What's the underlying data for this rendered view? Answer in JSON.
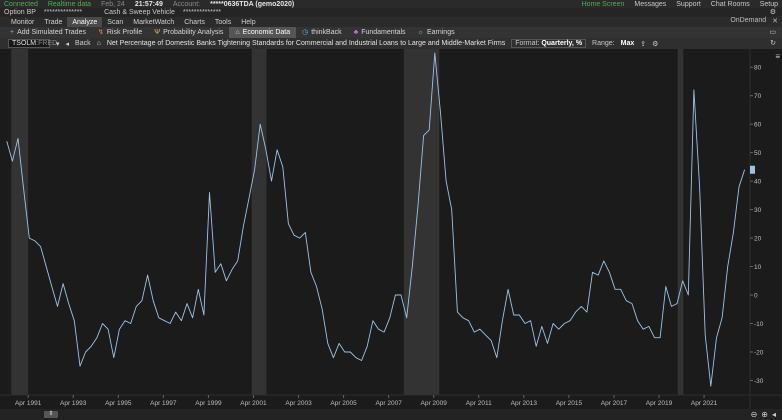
{
  "status": {
    "connected": "Connected",
    "realtime": "Realtime data",
    "date": "Feb, 24",
    "time": "21:57:49",
    "account_label": "Account:",
    "account_value": "*****0636TDA (gemo2020)",
    "home_screen": "Home Screen",
    "messages": "Messages",
    "support": "Support",
    "chat_rooms": "Chat Rooms",
    "setup": "Setup",
    "on_demand": "OnDemand"
  },
  "account_bar": {
    "option_bp_label": "Option BP",
    "option_bp_value": "**************",
    "cash_label": "Cash & Sweep Vehicle",
    "cash_value": "**************"
  },
  "main_tabs": [
    "Monitor",
    "Trade",
    "Analyze",
    "Scan",
    "MarketWatch",
    "Charts",
    "Tools",
    "Help"
  ],
  "active_main_tab": "Analyze",
  "sub_tabs": [
    {
      "label": "Add Simulated Trades",
      "icon": "plus-icon"
    },
    {
      "label": "Risk Profile",
      "icon": "chart-icon"
    },
    {
      "label": "Probability Analysis",
      "icon": "probability-icon"
    },
    {
      "label": "Economic Data",
      "icon": "bank-icon"
    },
    {
      "label": "thinkBack",
      "icon": "clock-icon"
    },
    {
      "label": "Fundamentals",
      "icon": "fundamentals-icon"
    },
    {
      "label": "Earnings",
      "icon": "bulb-icon"
    }
  ],
  "active_sub_tab": "Economic Data",
  "chart_toolbar": {
    "symbol": "TSOLM",
    "symbol_suffix": ":FRED",
    "back": "Back",
    "title": "Net Percentage of Domestic Banks Tightening Standards for Commercial and Industrial Loans to Large and Middle-Market Firms",
    "format_label": "Format:",
    "format_value": "Quarterly, %",
    "range_label": "Range:",
    "range_value": "Max"
  },
  "chart_data": {
    "type": "line",
    "title": "Net Percentage of Domestic Banks Tightening Standards for Commercial and Industrial Loans to Large and Middle-Market Firms",
    "xlabel": "",
    "ylabel": "",
    "x_ticks": [
      "Apr 1991",
      "Apr 1993",
      "Apr 1995",
      "Apr 1997",
      "Apr 1999",
      "Apr 2001",
      "Apr 2003",
      "Apr 2005",
      "Apr 2007",
      "Apr 2009",
      "Apr 2011",
      "Apr 2013",
      "Apr 2015",
      "Apr 2017",
      "Apr 2019",
      "Apr 2021"
    ],
    "y_ticks": [
      80,
      70,
      60,
      50,
      40,
      30,
      20,
      10,
      0,
      -10,
      -20,
      -30
    ],
    "ylim": [
      -33,
      85
    ],
    "xlim": [
      1990.0,
      2023.2
    ],
    "grid": false,
    "recessions": [
      [
        1990.5,
        1991.25
      ],
      [
        2001.17,
        2001.83
      ],
      [
        2007.92,
        2009.5
      ],
      [
        2020.08,
        2020.33
      ]
    ],
    "series": [
      {
        "color": "#9cc3e6",
        "points": [
          [
            1990.3,
            54
          ],
          [
            1990.55,
            47
          ],
          [
            1990.8,
            55
          ],
          [
            1991.05,
            37
          ],
          [
            1991.3,
            20
          ],
          [
            1991.55,
            19
          ],
          [
            1991.8,
            17
          ],
          [
            1992.05,
            10
          ],
          [
            1992.3,
            3
          ],
          [
            1992.55,
            -4
          ],
          [
            1992.8,
            4
          ],
          [
            1993.05,
            -3
          ],
          [
            1993.3,
            -9
          ],
          [
            1993.55,
            -25
          ],
          [
            1993.8,
            -20
          ],
          [
            1994.05,
            -18
          ],
          [
            1994.3,
            -15
          ],
          [
            1994.55,
            -10
          ],
          [
            1994.8,
            -12
          ],
          [
            1995.05,
            -22
          ],
          [
            1995.3,
            -12
          ],
          [
            1995.55,
            -9
          ],
          [
            1995.8,
            -10
          ],
          [
            1996.05,
            -4
          ],
          [
            1996.3,
            -2
          ],
          [
            1996.55,
            7
          ],
          [
            1996.8,
            -2
          ],
          [
            1997.05,
            -8
          ],
          [
            1997.3,
            -9
          ],
          [
            1997.55,
            -10
          ],
          [
            1997.8,
            -6
          ],
          [
            1998.05,
            -9
          ],
          [
            1998.3,
            -3
          ],
          [
            1998.55,
            -8
          ],
          [
            1998.8,
            2
          ],
          [
            1999.05,
            -7
          ],
          [
            1999.3,
            36
          ],
          [
            1999.55,
            8
          ],
          [
            1999.8,
            11
          ],
          [
            2000.05,
            5
          ],
          [
            2000.3,
            9
          ],
          [
            2000.55,
            12
          ],
          [
            2000.8,
            24
          ],
          [
            2001.05,
            34
          ],
          [
            2001.3,
            44
          ],
          [
            2001.55,
            60
          ],
          [
            2001.8,
            51
          ],
          [
            2002.05,
            40
          ],
          [
            2002.3,
            51
          ],
          [
            2002.55,
            45
          ],
          [
            2002.8,
            25
          ],
          [
            2003.05,
            21
          ],
          [
            2003.3,
            20
          ],
          [
            2003.55,
            22
          ],
          [
            2003.8,
            8
          ],
          [
            2004.05,
            3
          ],
          [
            2004.3,
            -5
          ],
          [
            2004.55,
            -17
          ],
          [
            2004.8,
            -22
          ],
          [
            2005.05,
            -17
          ],
          [
            2005.3,
            -20
          ],
          [
            2005.55,
            -20
          ],
          [
            2005.8,
            -22
          ],
          [
            2006.05,
            -23
          ],
          [
            2006.3,
            -18
          ],
          [
            2006.55,
            -9
          ],
          [
            2006.8,
            -12
          ],
          [
            2007.05,
            -13
          ],
          [
            2007.3,
            -8
          ],
          [
            2007.55,
            0
          ],
          [
            2007.8,
            0
          ],
          [
            2008.05,
            -8
          ],
          [
            2008.3,
            10
          ],
          [
            2008.55,
            31
          ],
          [
            2008.8,
            56
          ],
          [
            2009.05,
            58
          ],
          [
            2009.3,
            85
          ],
          [
            2009.55,
            64
          ],
          [
            2009.8,
            40
          ],
          [
            2010.05,
            30
          ],
          [
            2010.3,
            -6
          ],
          [
            2010.55,
            -8
          ],
          [
            2010.8,
            -9
          ],
          [
            2011.05,
            -13
          ],
          [
            2011.3,
            -12
          ],
          [
            2011.55,
            -14
          ],
          [
            2011.8,
            -16
          ],
          [
            2012.05,
            -22
          ],
          [
            2012.3,
            -9
          ],
          [
            2012.55,
            2
          ],
          [
            2012.8,
            -7
          ],
          [
            2013.05,
            -7
          ],
          [
            2013.3,
            -10
          ],
          [
            2013.55,
            -9
          ],
          [
            2013.8,
            -18
          ],
          [
            2014.05,
            -11
          ],
          [
            2014.3,
            -17
          ],
          [
            2014.55,
            -10
          ],
          [
            2014.8,
            -12
          ],
          [
            2015.05,
            -10
          ],
          [
            2015.3,
            -9
          ],
          [
            2015.55,
            -6
          ],
          [
            2015.8,
            -4
          ],
          [
            2016.05,
            -6
          ],
          [
            2016.3,
            8
          ],
          [
            2016.55,
            7
          ],
          [
            2016.8,
            12
          ],
          [
            2017.05,
            8
          ],
          [
            2017.3,
            2
          ],
          [
            2017.55,
            2
          ],
          [
            2017.8,
            -2
          ],
          [
            2018.05,
            -3
          ],
          [
            2018.3,
            -9
          ],
          [
            2018.55,
            -12
          ],
          [
            2018.8,
            -11
          ],
          [
            2019.05,
            -15
          ],
          [
            2019.3,
            -15
          ],
          [
            2019.55,
            3
          ],
          [
            2019.8,
            -4
          ],
          [
            2020.05,
            -3
          ],
          [
            2020.3,
            5
          ],
          [
            2020.55,
            0
          ],
          [
            2020.8,
            72
          ],
          [
            2021.05,
            38
          ],
          [
            2021.3,
            -14
          ],
          [
            2021.55,
            -32
          ],
          [
            2021.8,
            -15
          ],
          [
            2022.05,
            -8
          ],
          [
            2022.3,
            10
          ],
          [
            2022.55,
            22
          ],
          [
            2022.8,
            38
          ],
          [
            2023.05,
            44
          ]
        ]
      }
    ]
  }
}
